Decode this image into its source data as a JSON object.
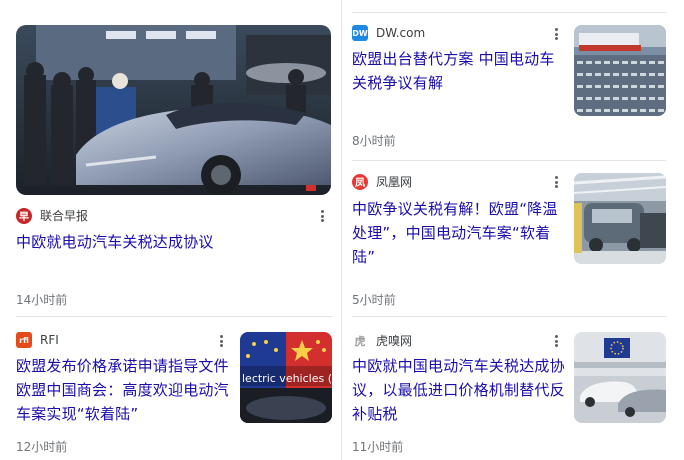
{
  "cards": [
    {
      "source": "联合早报",
      "title": "中欧就电动汽车关税达成协议",
      "time": "14小时前",
      "logo_color": "#c62828",
      "logo_char": "早"
    },
    {
      "source": "DW.com",
      "title": "欧盟出台替代方案 中国电动车关税争议有解",
      "time": "8小时前",
      "logo_color": "#1e88e5",
      "logo_char": "DW"
    },
    {
      "source": "凤凰网",
      "title": "中欧争议关税有解！欧盟“降温处理”，中国电动汽车案“软着陆”",
      "time": "5小时前",
      "logo_color": "#e53935",
      "logo_char": "凤"
    },
    {
      "source": "RFI",
      "title": "欧盟发布价格承诺申请指导文件 欧盟中国商会：高度欢迎电动汽车案实现“软着陆”",
      "time": "12小时前",
      "logo_color": "#e64a19",
      "logo_char": "rfi"
    },
    {
      "source": "虎嗅网",
      "title": "中欧就中国电动汽车关税达成协议，以最低进口价格机制替代反补贴税",
      "time": "11小时前",
      "logo_color": "#9e9e9e",
      "logo_char": "虎"
    }
  ],
  "thumb_text": "lectric vehicles (E"
}
